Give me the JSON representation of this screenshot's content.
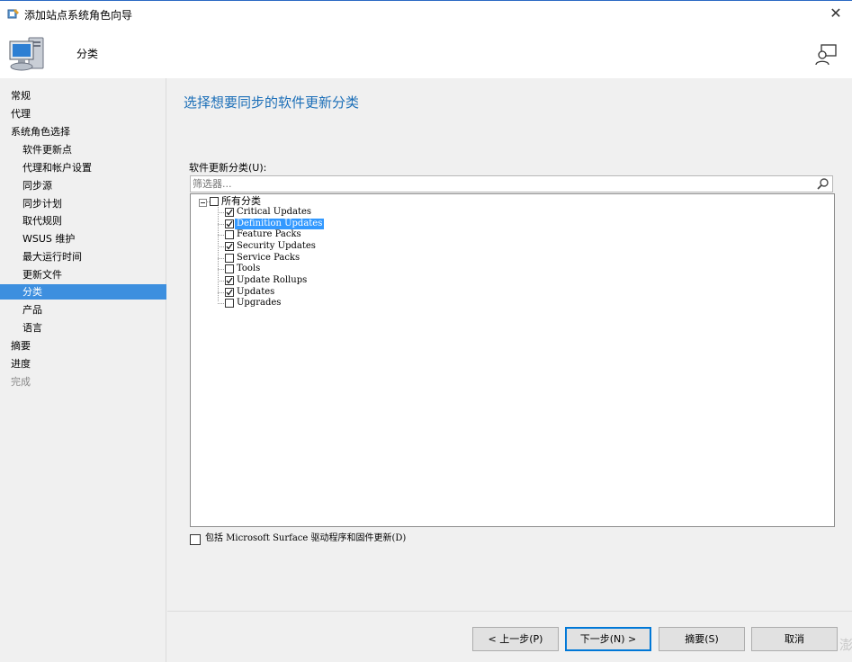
{
  "window": {
    "title": "添加站点系统角色向导",
    "close_glyph": "✕"
  },
  "header": {
    "title": "分类"
  },
  "sidebar": {
    "items": [
      {
        "label": "常规",
        "level": 1,
        "state": "normal"
      },
      {
        "label": "代理",
        "level": 1,
        "state": "normal"
      },
      {
        "label": "系统角色选择",
        "level": 1,
        "state": "normal"
      },
      {
        "label": "软件更新点",
        "level": 2,
        "state": "normal"
      },
      {
        "label": "代理和帐户设置",
        "level": 2,
        "state": "normal"
      },
      {
        "label": "同步源",
        "level": 2,
        "state": "normal"
      },
      {
        "label": "同步计划",
        "level": 2,
        "state": "normal"
      },
      {
        "label": "取代规则",
        "level": 2,
        "state": "normal"
      },
      {
        "label": "WSUS 维护",
        "level": 2,
        "state": "normal"
      },
      {
        "label": "最大运行时间",
        "level": 2,
        "state": "normal"
      },
      {
        "label": "更新文件",
        "level": 2,
        "state": "normal"
      },
      {
        "label": "分类",
        "level": 2,
        "state": "active"
      },
      {
        "label": "产品",
        "level": 2,
        "state": "normal"
      },
      {
        "label": "语言",
        "level": 2,
        "state": "normal"
      },
      {
        "label": "摘要",
        "level": 1,
        "state": "normal"
      },
      {
        "label": "进度",
        "level": 1,
        "state": "normal"
      },
      {
        "label": "完成",
        "level": 1,
        "state": "disabled"
      }
    ]
  },
  "main": {
    "heading": "选择想要同步的软件更新分类",
    "classes_label": "软件更新分类(U):",
    "filter": {
      "placeholder": "筛选器...",
      "value": ""
    },
    "tree": {
      "root": {
        "label": "所有分类",
        "checked": false,
        "expanded": true
      },
      "items": [
        {
          "label": "Critical Updates",
          "checked": true,
          "selected": false
        },
        {
          "label": "Definition Updates",
          "checked": true,
          "selected": true
        },
        {
          "label": "Feature Packs",
          "checked": false,
          "selected": false
        },
        {
          "label": "Security Updates",
          "checked": true,
          "selected": false
        },
        {
          "label": "Service Packs",
          "checked": false,
          "selected": false
        },
        {
          "label": "Tools",
          "checked": false,
          "selected": false
        },
        {
          "label": "Update Rollups",
          "checked": true,
          "selected": false
        },
        {
          "label": "Updates",
          "checked": true,
          "selected": false
        },
        {
          "label": "Upgrades",
          "checked": false,
          "selected": false
        }
      ]
    },
    "surface_option": {
      "label": "包括 Microsoft Surface 驱动程序和固件更新(D)",
      "checked": false
    }
  },
  "buttons": {
    "back": "< 上一步(P)",
    "next": "下一步(N) >",
    "summary": "摘要(S)",
    "cancel": "取消"
  },
  "watermark": "澎",
  "colors": {
    "accent": "#3d8fdf",
    "heading": "#1c6fb8",
    "selection": "#3399ff"
  },
  "icons": {
    "app": "wizard-icon",
    "header": "computer-icon",
    "help": "feedback-icon",
    "search": "search-icon"
  }
}
